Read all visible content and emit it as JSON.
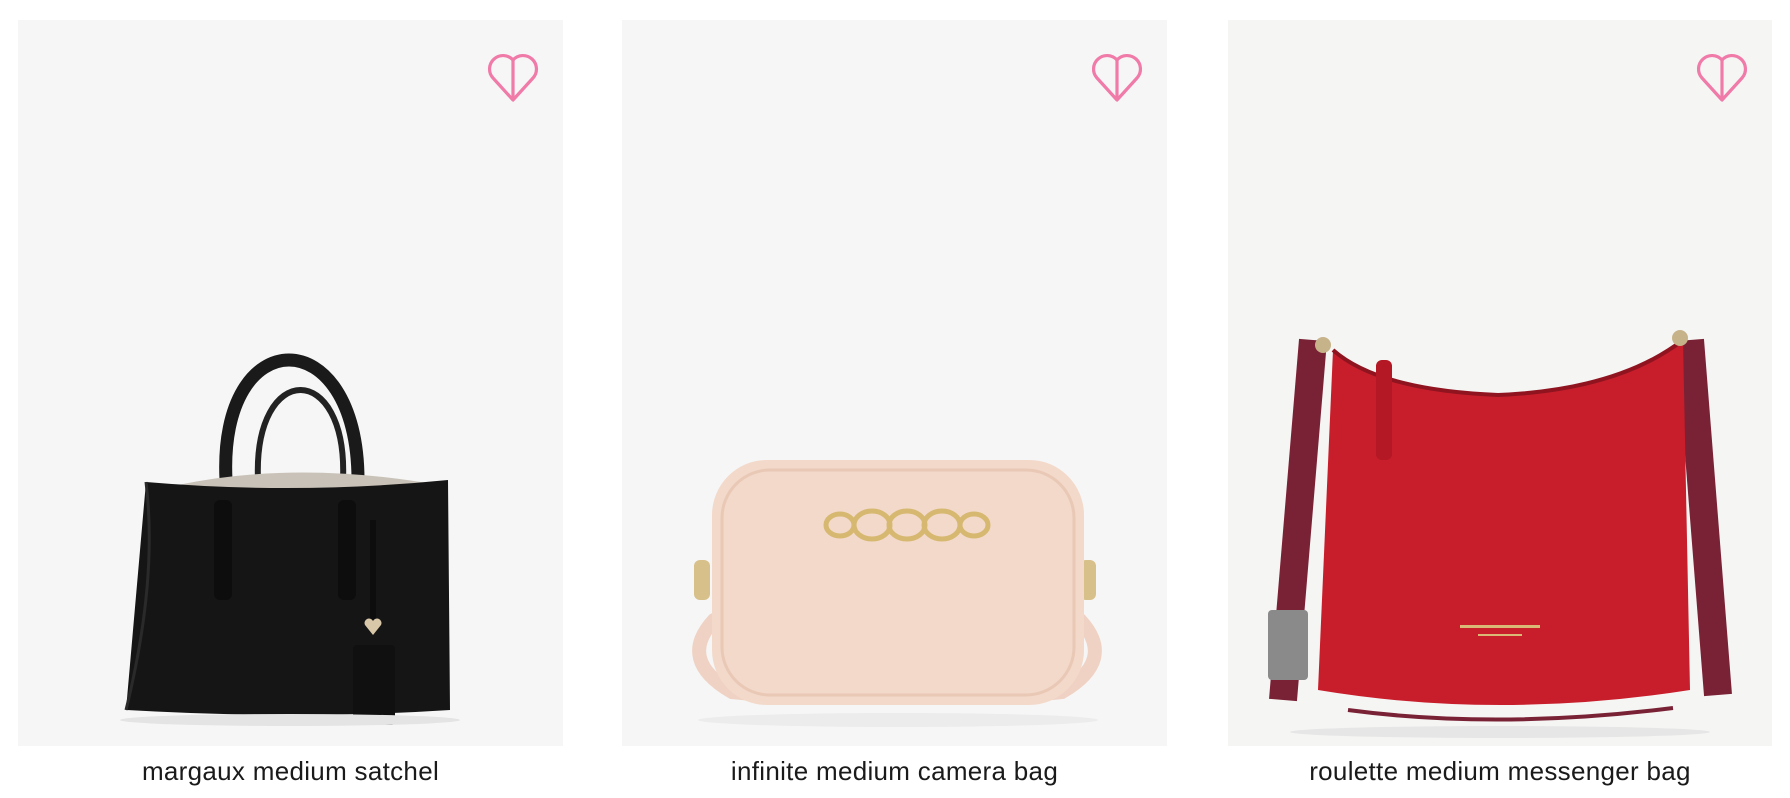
{
  "products": [
    {
      "name": "margaux medium satchel",
      "wishlist_icon": "heart-outline-icon",
      "image": "black-satchel-image"
    },
    {
      "name": "infinite medium camera bag",
      "wishlist_icon": "heart-outline-icon",
      "image": "blush-camera-bag-image"
    },
    {
      "name": "roulette medium messenger bag",
      "wishlist_icon": "heart-outline-icon",
      "image": "red-messenger-bag-image"
    }
  ],
  "colors": {
    "accent_pink": "#f07aa8",
    "tile_background": "#f6f6f6",
    "text": "#1a1a1a"
  }
}
